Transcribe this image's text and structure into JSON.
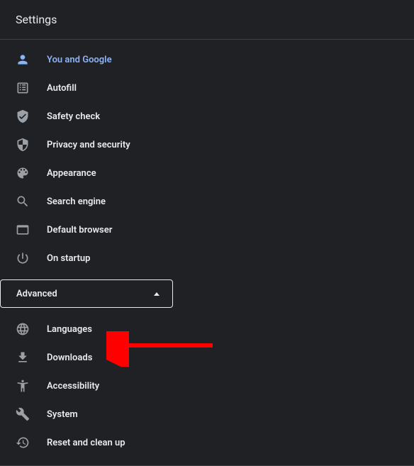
{
  "header": {
    "title": "Settings"
  },
  "nav": {
    "items": [
      {
        "id": "you-and-google",
        "label": "You and Google",
        "active": true
      },
      {
        "id": "autofill",
        "label": "Autofill",
        "active": false
      },
      {
        "id": "safety-check",
        "label": "Safety check",
        "active": false
      },
      {
        "id": "privacy-security",
        "label": "Privacy and security",
        "active": false
      },
      {
        "id": "appearance",
        "label": "Appearance",
        "active": false
      },
      {
        "id": "search-engine",
        "label": "Search engine",
        "active": false
      },
      {
        "id": "default-browser",
        "label": "Default browser",
        "active": false
      },
      {
        "id": "on-startup",
        "label": "On startup",
        "active": false
      }
    ]
  },
  "advanced": {
    "label": "Advanced",
    "expanded": true,
    "items": [
      {
        "id": "languages",
        "label": "Languages"
      },
      {
        "id": "downloads",
        "label": "Downloads"
      },
      {
        "id": "accessibility",
        "label": "Accessibility"
      },
      {
        "id": "system",
        "label": "System"
      },
      {
        "id": "reset-cleanup",
        "label": "Reset and clean up"
      }
    ]
  },
  "annotation": {
    "type": "arrow",
    "target": "downloads",
    "color": "#ff0000"
  }
}
